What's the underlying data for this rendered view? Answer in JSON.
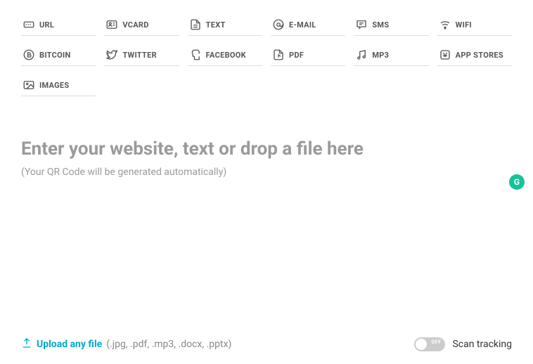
{
  "tabs": [
    {
      "label": "URL"
    },
    {
      "label": "VCARD"
    },
    {
      "label": "TEXT"
    },
    {
      "label": "E-MAIL"
    },
    {
      "label": "SMS"
    },
    {
      "label": "WIFI"
    },
    {
      "label": "BITCOIN"
    },
    {
      "label": "TWITTER"
    },
    {
      "label": "FACEBOOK"
    },
    {
      "label": "PDF"
    },
    {
      "label": "MP3"
    },
    {
      "label": "APP STORES"
    },
    {
      "label": "IMAGES"
    }
  ],
  "input": {
    "placeholder_title": "Enter your website, text or drop a file here",
    "placeholder_sub": "(Your QR Code will be generated automatically)"
  },
  "upload": {
    "label": "Upload any file",
    "hint": "(.jpg, .pdf, .mp3, .docx, .pptx)"
  },
  "scan_tracking": {
    "label": "Scan tracking",
    "toggle_state": "OFF"
  },
  "grammarly_badge": "G"
}
